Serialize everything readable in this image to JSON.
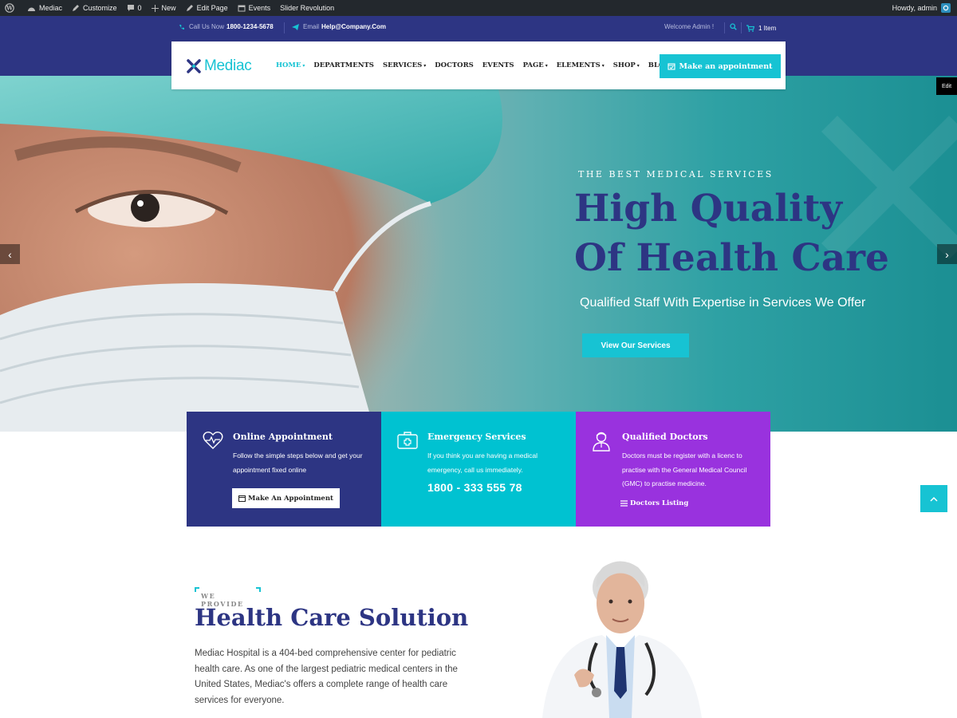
{
  "adminbar": {
    "site_name": "Mediac",
    "customize": "Customize",
    "comments": "0",
    "new": "New",
    "edit_page": "Edit Page",
    "events": "Events",
    "slider": "Slider Revolution",
    "howdy": "Howdy, admin"
  },
  "topbar": {
    "call_label": "Call Us Now",
    "phone": "1800-1234-5678",
    "email_label": "Email",
    "email": "Help@Company.Com",
    "welcome": "Welcome Admin !",
    "cart": "1 Item"
  },
  "header": {
    "logo": "Mediac",
    "nav": [
      {
        "label": "HOME",
        "dropdown": true,
        "active": true
      },
      {
        "label": "DEPARTMENTS",
        "dropdown": false
      },
      {
        "label": "SERVICES",
        "dropdown": true
      },
      {
        "label": "DOCTORS",
        "dropdown": false
      },
      {
        "label": "EVENTS",
        "dropdown": false
      },
      {
        "label": "PAGE",
        "dropdown": true
      },
      {
        "label": "ELEMENTS",
        "dropdown": true
      },
      {
        "label": "SHOP",
        "dropdown": true
      },
      {
        "label": "BLOG",
        "dropdown": true
      }
    ],
    "appointment_button": "Make an appointment"
  },
  "hero": {
    "subtitle": "THE BEST MEDICAL SERVICES",
    "title_line1": "High Quality",
    "title_line2": "Of Health Care",
    "tagline": "Qualified Staff With Expertise in Services We Offer",
    "button": "View Our Services",
    "edit": "Edit"
  },
  "features": [
    {
      "title": "Online Appointment",
      "text": "Follow the simple steps below and get your appointment fixed online",
      "button": "Make An Appointment"
    },
    {
      "title": "Emergency Services",
      "text": "If you think you are having a medical emergency, call us immediately.",
      "phone": "1800 - 333 555 78"
    },
    {
      "title": "Qualified Doctors",
      "text": "Doctors must be register with a licenc to practise with the General Medical Council (GMC) to practise medicine.",
      "link": "Doctors Listing"
    }
  ],
  "about": {
    "eyebrow": "WE PROVIDE",
    "title": "Health Care Solution",
    "text": "Mediac Hospital is a 404-bed comprehensive center for pediatric health care. As one of the largest pediatric medical centers in the United States, Mediac's offers a complete range of health care services for everyone."
  },
  "colors": {
    "primary": "#2d3583",
    "accent": "#17c3d3",
    "feature_2": "#00c2d1",
    "feature_3": "#9932de"
  },
  "icons": [
    "wordpress-icon",
    "gauge-icon",
    "pencil-icon",
    "comment-icon",
    "plus-icon",
    "calendar-icon",
    "phone-icon",
    "paper-plane-icon",
    "search-icon",
    "cart-icon",
    "heart-pulse-icon",
    "medical-kit-icon",
    "doctor-icon",
    "list-icon",
    "chevron-up-icon"
  ]
}
